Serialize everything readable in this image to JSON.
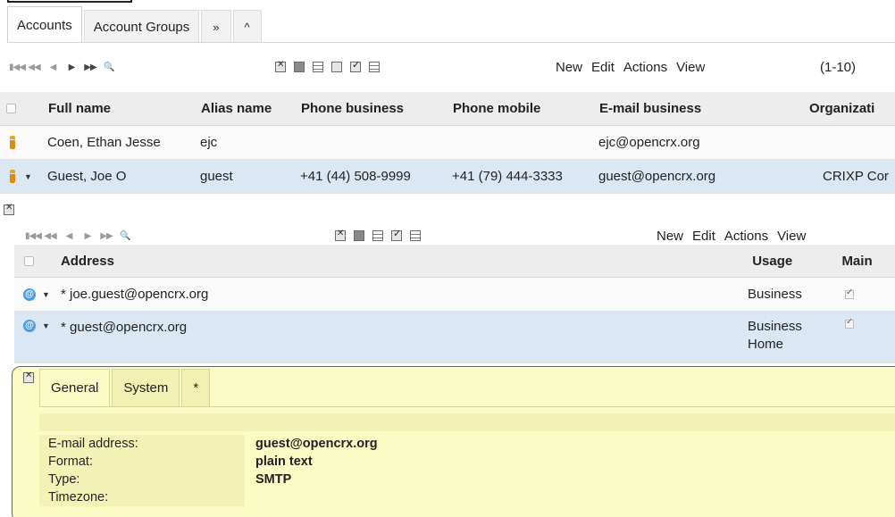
{
  "top_tabs": [
    {
      "label": "Accounts",
      "active": true
    },
    {
      "label": "Account Groups",
      "active": false
    },
    {
      "label": "»",
      "active": false
    },
    {
      "label": "^",
      "active": false
    }
  ],
  "accounts_toolbar": {
    "menu": [
      "New",
      "Edit",
      "Actions",
      "View"
    ],
    "page_range": "(1-10)"
  },
  "accounts_table": {
    "columns": [
      "Full name",
      "Alias name",
      "Phone business",
      "Phone mobile",
      "E-mail business",
      "Organizati"
    ],
    "rows": [
      {
        "full_name": "Coen, Ethan Jesse",
        "alias": "ejc",
        "phone_business": "",
        "phone_mobile": "",
        "email": "ejc@opencrx.org",
        "org": ""
      },
      {
        "full_name": "Guest, Joe O",
        "alias": "guest",
        "phone_business": "+41 (44) 508-9999",
        "phone_mobile": "+41 (79) 444-3333",
        "email": "guest@opencrx.org",
        "org": "CRIXP Cor"
      }
    ]
  },
  "address_toolbar": {
    "menu": [
      "New",
      "Edit",
      "Actions",
      "View"
    ]
  },
  "address_table": {
    "columns": [
      "Address",
      "Usage",
      "Main"
    ],
    "rows": [
      {
        "address": "* joe.guest@opencrx.org",
        "usage": "Business",
        "main": true
      },
      {
        "address": "* guest@opencrx.org",
        "usage": "Business\nHome",
        "main": true
      }
    ]
  },
  "detail_panel": {
    "tabs": [
      {
        "label": "General",
        "active": true
      },
      {
        "label": "System",
        "active": false
      },
      {
        "label": "*",
        "active": false
      }
    ],
    "fields": [
      {
        "label": "E-mail address:",
        "value": "guest@opencrx.org"
      },
      {
        "label": "Format:",
        "value": "plain text"
      },
      {
        "label": "Type:",
        "value": "SMTP"
      },
      {
        "label": "Timezone:",
        "value": ""
      }
    ]
  },
  "colors": {
    "selected_row": "#dbe8f3",
    "detail_bg": "#fbfbc6",
    "header_bg": "#ededed"
  }
}
